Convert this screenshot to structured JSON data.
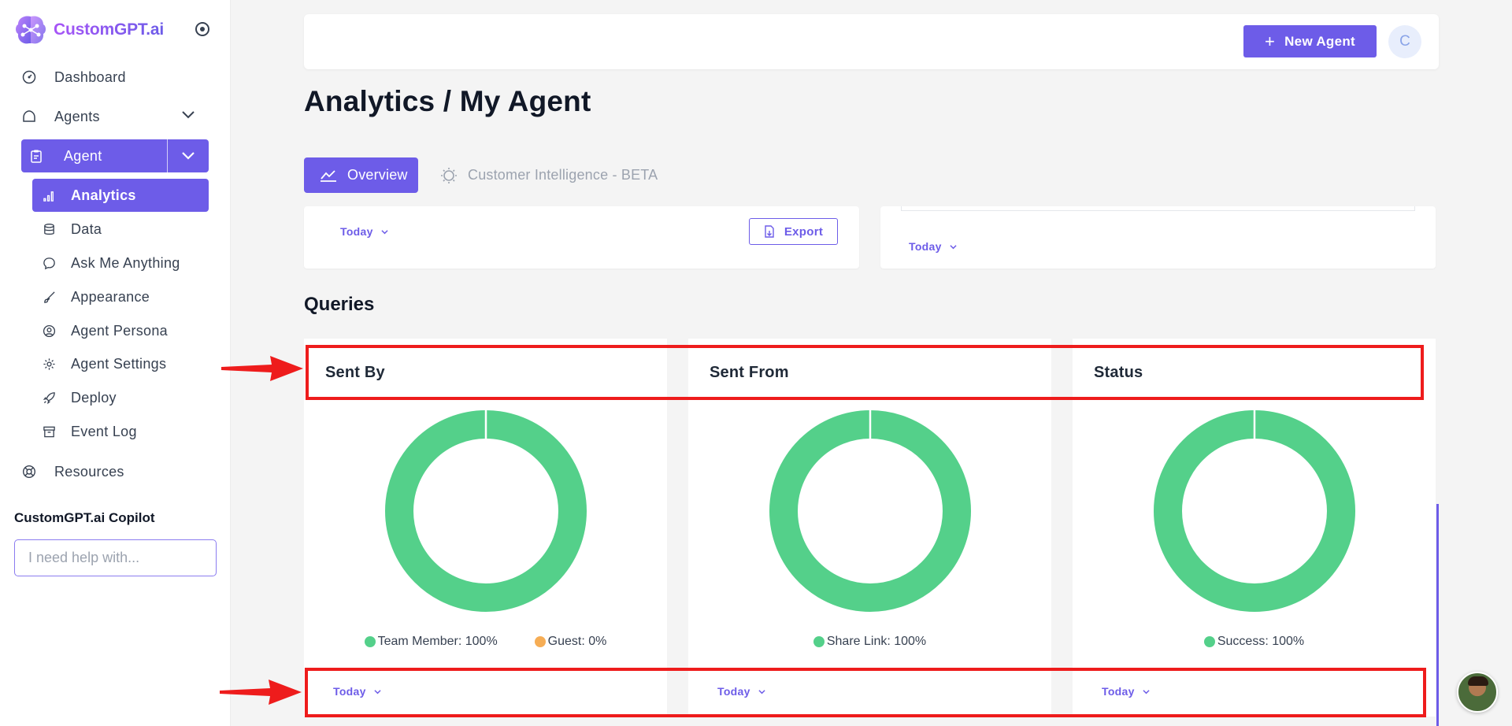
{
  "brand": {
    "name": "CustomGPT.ai"
  },
  "sidebar": {
    "dashboard": "Dashboard",
    "agents": "Agents",
    "agent": "Agent",
    "items": [
      {
        "label": "Analytics",
        "icon": "bar-chart-icon"
      },
      {
        "label": "Data",
        "icon": "database-icon"
      },
      {
        "label": "Ask Me Anything",
        "icon": "chat-bubble-icon"
      },
      {
        "label": "Appearance",
        "icon": "brush-icon"
      },
      {
        "label": "Agent Persona",
        "icon": "user-circle-icon"
      },
      {
        "label": "Agent Settings",
        "icon": "gear-icon"
      },
      {
        "label": "Deploy",
        "icon": "rocket-icon"
      },
      {
        "label": "Event Log",
        "icon": "archive-icon"
      }
    ],
    "resources": "Resources",
    "copilot": {
      "title": "CustomGPT.ai Copilot",
      "placeholder": "I need help with..."
    }
  },
  "header": {
    "new_agent": "New Agent",
    "avatar_initial": "C"
  },
  "page": {
    "title": "Analytics / My Agent"
  },
  "tabs": {
    "overview": "Overview",
    "customer_intelligence": "Customer Intelligence - BETA"
  },
  "top_cards": {
    "left_period": "Today",
    "export": "Export",
    "right_period": "Today"
  },
  "queries": {
    "title": "Queries",
    "cards": [
      {
        "title": "Sent By",
        "legend": [
          {
            "label": "Team Member: 100%",
            "color": "#54d08a",
            "percent": 100
          },
          {
            "label": "Guest: 0%",
            "color": "#f6ad55",
            "percent": 0
          }
        ],
        "period": "Today"
      },
      {
        "title": "Sent From",
        "legend": [
          {
            "label": "Share Link: 100%",
            "color": "#54d08a",
            "percent": 100
          }
        ],
        "period": "Today"
      },
      {
        "title": "Status",
        "legend": [
          {
            "label": "Success: 100%",
            "color": "#54d08a",
            "percent": 100
          }
        ],
        "period": "Today"
      }
    ]
  },
  "colors": {
    "accent": "#6d5ce8",
    "success": "#54d08a",
    "warning": "#f6ad55",
    "annotation": "#ee1c1c"
  }
}
